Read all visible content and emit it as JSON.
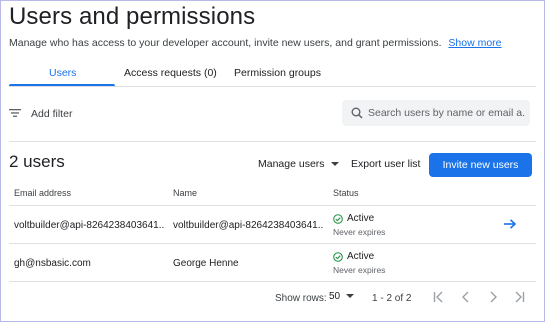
{
  "header": {
    "title": "Users and permissions",
    "subtitle": "Manage who has access to your developer account, invite new users, and grant permissions.",
    "show_more": "Show more"
  },
  "tabs": [
    {
      "label": "Users",
      "active": true
    },
    {
      "label": "Access requests (0)",
      "active": false
    },
    {
      "label": "Permission groups",
      "active": false
    }
  ],
  "filter": {
    "label": "Add filter",
    "icon": "filter-icon"
  },
  "search": {
    "placeholder": "Search users by name or email a...",
    "value": ""
  },
  "toolbar": {
    "count": "2 users",
    "manage_users": "Manage users",
    "export": "Export user list",
    "invite": "Invite new users"
  },
  "table": {
    "headers": [
      "Email address",
      "Name",
      "Status"
    ],
    "rows": [
      {
        "email": "voltbuilder@api-8264238403641...",
        "name": "voltbuilder@api-8264238403641...",
        "status": "Active",
        "expiry": "Never expires"
      },
      {
        "email": "gh@nsbasic.com",
        "name": "George Henne",
        "status": "Active",
        "expiry": "Never expires"
      }
    ]
  },
  "pagination": {
    "show_rows_label": "Show rows:",
    "rows_value": "50",
    "range": "1 - 2 of 2"
  },
  "colors": {
    "accent": "#1a73e8",
    "success": "#1e8e3e"
  }
}
